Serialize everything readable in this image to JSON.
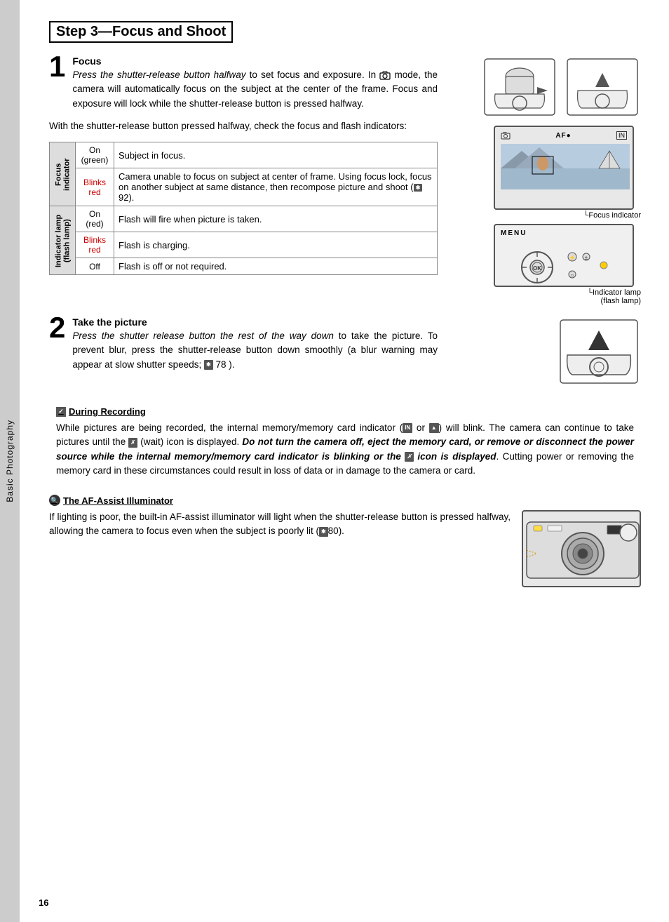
{
  "sidebar": {
    "label": "Basic Photography"
  },
  "page": {
    "title": "Step 3—Focus and Shoot",
    "number": "16"
  },
  "step1": {
    "number": "1",
    "title": "Focus",
    "body_italic_part": "Press the shutter-release button halfway",
    "body_rest": " to set focus and exposure.  In",
    "body_cont": " mode, the camera will automatically focus on the subject at the center of the frame.  Focus and exposure will lock while the shutter-release button is pressed halfway.",
    "halfpress_intro": "With the shutter-release button pressed halfway, check the focus and flash indicators:"
  },
  "table": {
    "row1_header": "Focus indicator",
    "row1_state1": "On (green)",
    "row1_desc1": "Subject in focus.",
    "row1_state2": "Blinks red",
    "row1_desc2": "Camera unable to focus on subject at center of frame.  Using focus lock, focus on another subject at same distance, then recompose picture and shoot (",
    "row1_ref2": "92",
    "row1_desc2_end": ").",
    "row2_header": "Indicator lamp (flash lamp)",
    "row2_state1": "On (red)",
    "row2_desc1": "Flash will fire when picture is taken.",
    "row2_state2": "Blinks red",
    "row2_desc2": "Flash is charging.",
    "row2_state3": "Off",
    "row2_desc3": "Flash is off or not required."
  },
  "focus_indicator_label": "Focus indicator",
  "indicator_lamp_label": "Indicator lamp\n(flash lamp)",
  "step2": {
    "number": "2",
    "title": "Take the picture",
    "body_italic": "Press the shutter release button the rest of the way down",
    "body_rest": " to take the picture.  To prevent blur, press the shutter-release button down smoothly (a blur warning may appear at slow shutter speeds;",
    "body_ref": "78",
    "body_end": ")."
  },
  "during_recording": {
    "title": "During Recording",
    "text1": "While pictures are being recorded, the internal memory/memory card indicator (",
    "icon1": "IN",
    "text2": " or ",
    "icon2": "↑",
    "text3": ") will blink.  The camera can continue to take pictures until the ",
    "icon3": "X",
    "text4": " (wait) icon is displayed.  ",
    "bold_text": "Do not turn the camera off, eject the memory card, or remove or disconnect the power source while the internal memory/memory card indicator is blinking or the",
    "icon4": "X",
    "bold_text2": " icon is displayed",
    "text5": ".  Cutting power or removing the memory card in these circumstances could result in loss of data or in damage to the camera or card."
  },
  "af_assist": {
    "title": "The AF-Assist Illuminator",
    "text": "If lighting is poor, the built-in AF-assist illuminator will light when the shutter-release button is pressed halfway, allowing the camera to focus even when the subject is poorly lit (",
    "ref": "80",
    "text_end": ")."
  }
}
